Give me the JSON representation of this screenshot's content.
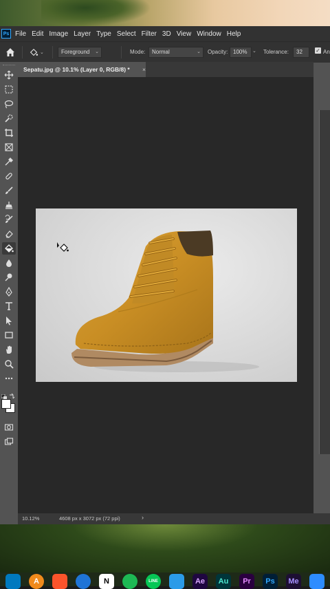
{
  "app": {
    "logo_text": "Ps"
  },
  "menu": {
    "items": [
      "File",
      "Edit",
      "Image",
      "Layer",
      "Type",
      "Select",
      "Filter",
      "3D",
      "View",
      "Window",
      "Help"
    ]
  },
  "options": {
    "fill_source": "Foreground",
    "mode_label": "Mode:",
    "mode_value": "Normal",
    "opacity_label": "Opacity:",
    "opacity_value": "100%",
    "tolerance_label": "Tolerance:",
    "tolerance_value": "32",
    "antialias_label": "An"
  },
  "document": {
    "tab_title": "Sepatu.jpg @ 10.1% (Layer 0, RGB/8) *",
    "close_glyph": "×"
  },
  "status": {
    "zoom": "10.12%",
    "dimensions": "4608 px x 3072 px (72 ppi)",
    "arrow": "›"
  },
  "toolbar": {
    "tools": [
      "move-tool",
      "marquee-tool",
      "lasso-tool",
      "quick-selection-tool",
      "crop-tool",
      "frame-tool",
      "eyedropper-tool",
      "healing-brush-tool",
      "brush-tool",
      "clone-stamp-tool",
      "history-brush-tool",
      "eraser-tool",
      "paint-bucket-tool",
      "blur-tool",
      "dodge-tool",
      "pen-tool",
      "type-tool",
      "path-selection-tool",
      "rectangle-tool",
      "hand-tool",
      "zoom-tool",
      "more-tools"
    ],
    "active_tool": "paint-bucket-tool",
    "foreground_color": "#ffffff",
    "background_color": "#ffffff"
  },
  "taskbar": {
    "apps": [
      {
        "name": "trello",
        "text": "",
        "color": "#0079bf"
      },
      {
        "name": "app-a",
        "text": "A",
        "color": "#f08a1c"
      },
      {
        "name": "brave",
        "text": "",
        "color": "#fb542b"
      },
      {
        "name": "browser",
        "text": "",
        "color": "#1f74d6"
      },
      {
        "name": "notion",
        "text": "N",
        "color": "#ffffff"
      },
      {
        "name": "spotify",
        "text": "",
        "color": "#1db954"
      },
      {
        "name": "line",
        "text": "LINE",
        "color": "#06c755"
      },
      {
        "name": "files",
        "text": "",
        "color": "#2b9be8"
      },
      {
        "name": "after-effects",
        "text": "Ae",
        "color": "#1f0740"
      },
      {
        "name": "audition",
        "text": "Au",
        "color": "#00353a"
      },
      {
        "name": "premiere",
        "text": "Pr",
        "color": "#2a003f"
      },
      {
        "name": "photoshop",
        "text": "Ps",
        "color": "#001e36"
      },
      {
        "name": "media-encoder",
        "text": "Me",
        "color": "#1d0f33"
      },
      {
        "name": "zoom",
        "text": "",
        "color": "#2d8cff"
      }
    ]
  }
}
